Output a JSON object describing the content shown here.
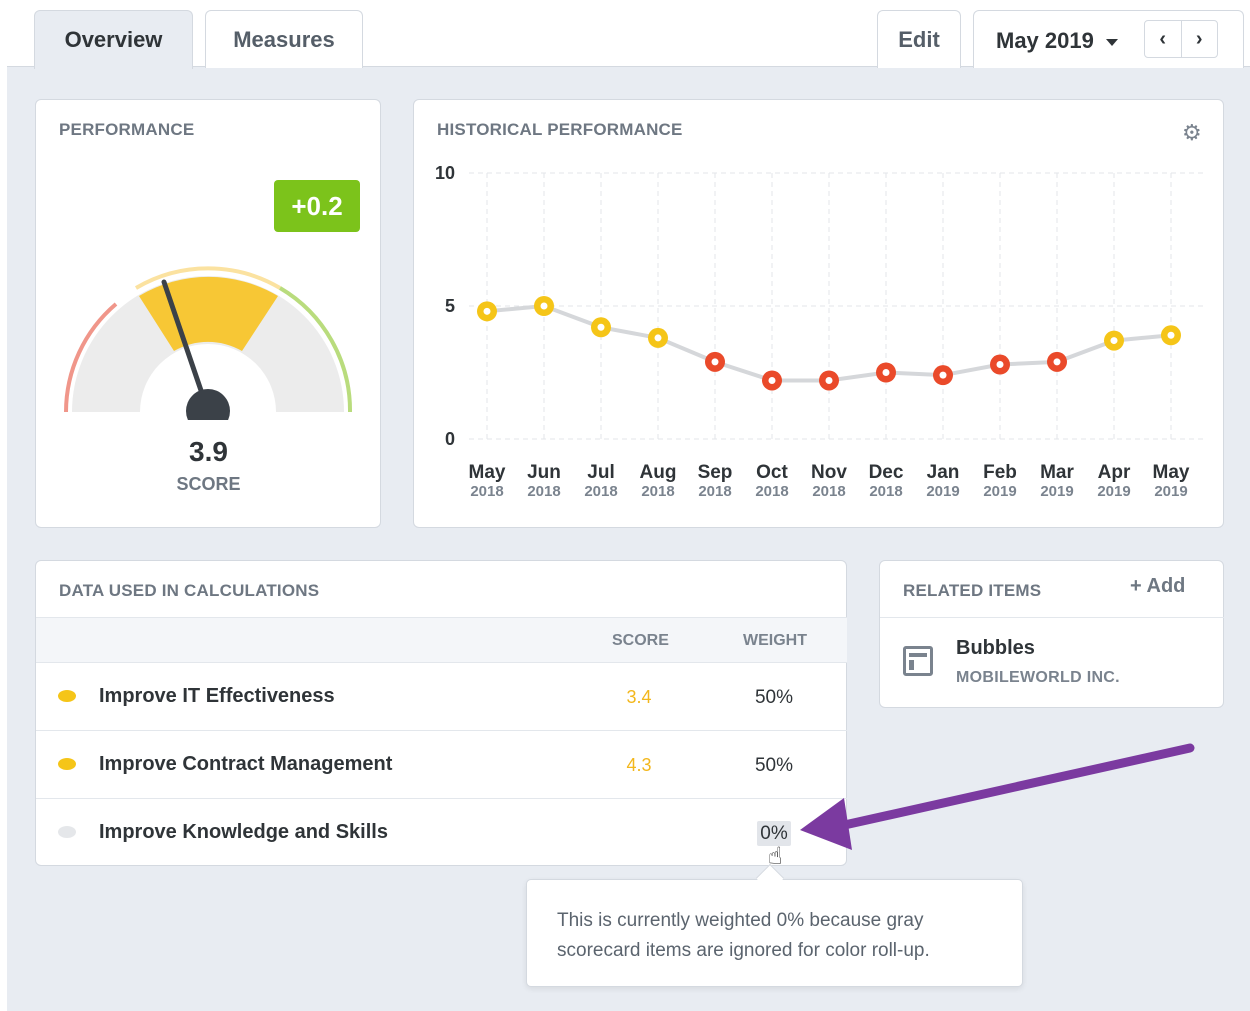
{
  "tabs": [
    {
      "label": "Overview",
      "active": true
    },
    {
      "label": "Measures",
      "active": false
    }
  ],
  "header": {
    "edit_label": "Edit",
    "period_label": "May 2019",
    "prev_icon": "‹",
    "next_icon": "›"
  },
  "performance": {
    "title": "PERFORMANCE",
    "change": "+0.2",
    "score": "3.9",
    "score_label": "SCORE",
    "gauge_value": 3.9,
    "gauge_max": 10
  },
  "historical": {
    "title": "HISTORICAL PERFORMANCE",
    "settings_icon": "gear-icon"
  },
  "chart_data": {
    "type": "line",
    "title": "HISTORICAL PERFORMANCE",
    "categories": [
      "May",
      "Jun",
      "Jul",
      "Aug",
      "Sep",
      "Oct",
      "Nov",
      "Dec",
      "Jan",
      "Feb",
      "Mar",
      "Apr",
      "May"
    ],
    "category_years": [
      "2018",
      "2018",
      "2018",
      "2018",
      "2018",
      "2018",
      "2018",
      "2018",
      "2019",
      "2019",
      "2019",
      "2019",
      "2019"
    ],
    "values": [
      4.8,
      5.0,
      4.2,
      3.8,
      2.9,
      2.2,
      2.2,
      2.5,
      2.4,
      2.8,
      2.9,
      3.7,
      3.9
    ],
    "point_status": [
      "yellow",
      "yellow",
      "yellow",
      "yellow",
      "red",
      "red",
      "red",
      "red",
      "red",
      "red",
      "red",
      "yellow",
      "yellow"
    ],
    "yticks": [
      "0",
      "5",
      "10"
    ],
    "ylim": [
      0,
      10
    ],
    "grid": true
  },
  "calculations": {
    "title": "DATA USED IN CALCULATIONS",
    "col_score": "SCORE",
    "col_weight": "WEIGHT",
    "rows": [
      {
        "name": "Improve IT Effectiveness",
        "score": "3.4",
        "weight": "50%",
        "status": "yellow"
      },
      {
        "name": "Improve Contract Management",
        "score": "4.3",
        "weight": "50%",
        "status": "yellow"
      },
      {
        "name": "Improve Knowledge and Skills",
        "score": "",
        "weight": "0%",
        "status": "gray"
      }
    ]
  },
  "related": {
    "title": "RELATED ITEMS",
    "add_label": "+ Add",
    "item_name": "Bubbles",
    "item_sub": "MOBILEWORLD INC."
  },
  "tooltip": {
    "text": "This is currently weighted 0% because gray scorecard items are ignored for color roll-up."
  },
  "colors": {
    "yellow": "#f5c518",
    "red": "#ea4a2a",
    "gray": "#e5e7ea",
    "green": "#7cc31b",
    "annotation": "#7b3aa0"
  }
}
